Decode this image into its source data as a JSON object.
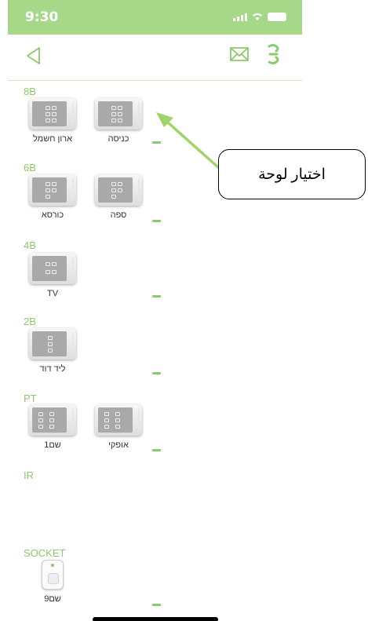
{
  "status": {
    "time": "9:30"
  },
  "accent_color": "#8ccb6c",
  "status_bar_color": "#a7d88a",
  "nav": {
    "back_icon": "back-triangle-icon",
    "mail_icon": "envelope-icon",
    "menu_icon": "menu-icon"
  },
  "sections": [
    {
      "title": "8B",
      "devices": [
        "ארון חשמל",
        "כניסה"
      ]
    },
    {
      "title": "6B",
      "devices": [
        "כורסא",
        "ספה"
      ]
    },
    {
      "title": "4B",
      "devices": [
        "TV"
      ]
    },
    {
      "title": "2B",
      "devices": [
        "ליד דוד"
      ]
    },
    {
      "title": "PT",
      "devices": [
        "שם1",
        "אופקי"
      ]
    },
    {
      "title": "IR",
      "devices": []
    },
    {
      "title": "SOCKET",
      "devices": [
        "שם9"
      ]
    }
  ],
  "annotation": {
    "label": "اختيار لوحة"
  }
}
